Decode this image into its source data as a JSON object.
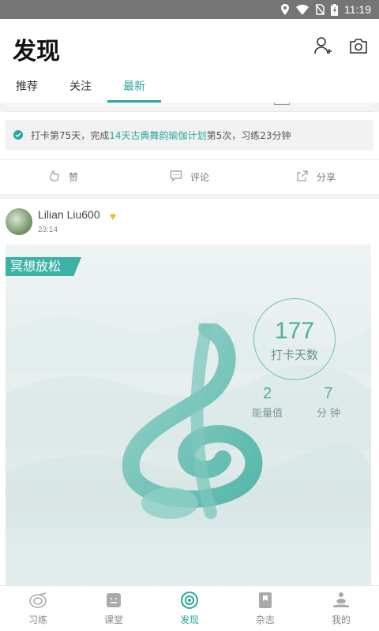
{
  "status_bar": {
    "time": "11:19"
  },
  "header": {
    "title": "发现"
  },
  "tabs": [
    {
      "label": "推荐"
    },
    {
      "label": "关注"
    },
    {
      "label": "最新"
    }
  ],
  "checkin": {
    "part1": "打卡第75天，完成",
    "plan": "14天古典舞韵瑜伽计划",
    "part2": "第5次，习练23分钟"
  },
  "actions": {
    "like": "赞",
    "comment": "评论",
    "share": "分享"
  },
  "post": {
    "username": "Lilian Liu600",
    "time": "23:14",
    "ribbon": "冥想放松",
    "days": "177",
    "days_label": "打卡天数",
    "energy_value": "2",
    "energy_label": "能量值",
    "minutes_value": "7",
    "minutes_label": "分 钟"
  },
  "bottom_nav": [
    {
      "label": "习练"
    },
    {
      "label": "课堂"
    },
    {
      "label": "发现"
    },
    {
      "label": "杂志"
    },
    {
      "label": "我的"
    }
  ],
  "colors": {
    "accent": "#2aa89b",
    "status_bar": "#757575"
  },
  "icons": [
    "location-icon",
    "wifi-icon",
    "no-sim-icon",
    "battery-icon",
    "add-friend-icon",
    "camera-icon",
    "check-icon",
    "like-icon",
    "comment-icon",
    "share-icon",
    "vip-icon",
    "practice-icon",
    "classroom-icon",
    "discover-icon",
    "magazine-icon",
    "profile-icon"
  ]
}
